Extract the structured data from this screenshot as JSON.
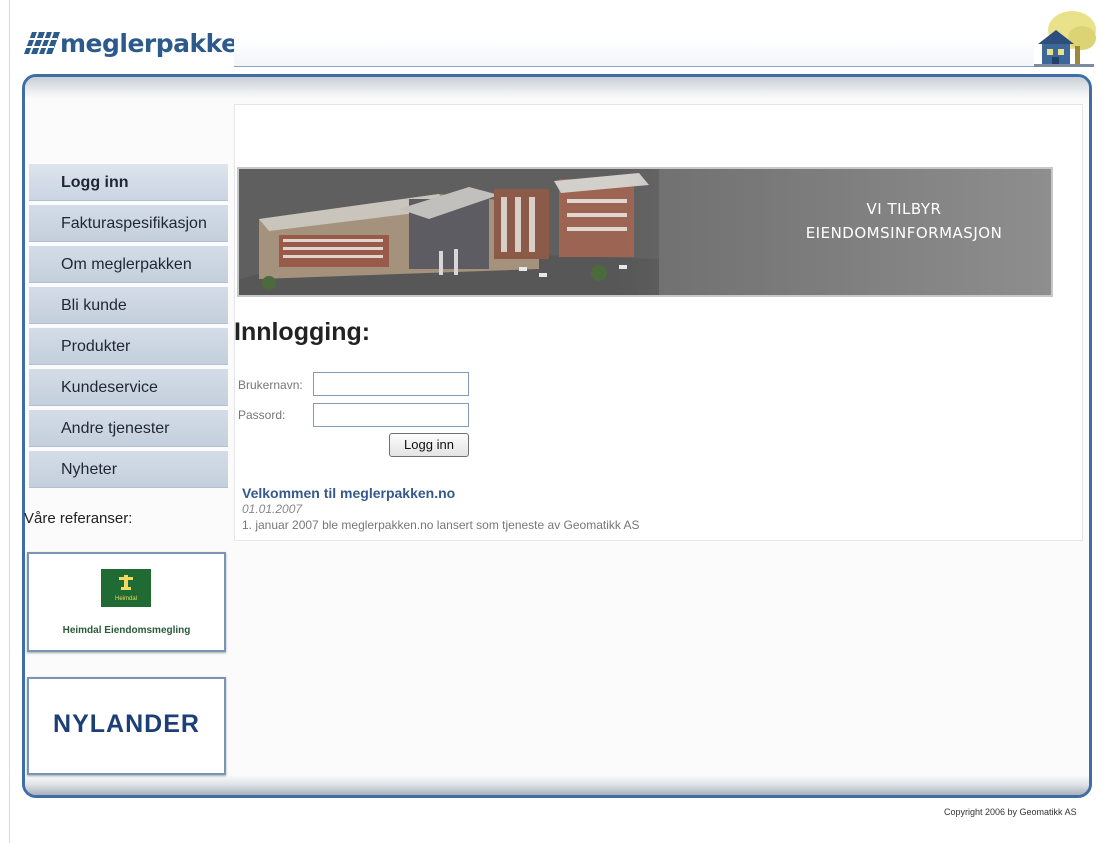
{
  "header": {
    "logo_text": "meglerpakken"
  },
  "sidebar": {
    "items": [
      {
        "label": "Logg inn"
      },
      {
        "label": "Fakturaspesifikasjon"
      },
      {
        "label": "Om meglerpakken"
      },
      {
        "label": "Bli kunde"
      },
      {
        "label": "Produkter"
      },
      {
        "label": "Kundeservice"
      },
      {
        "label": "Andre tjenester"
      },
      {
        "label": "Nyheter"
      }
    ],
    "active_index": 0,
    "references_label": "Våre referanser:",
    "references": [
      {
        "name": "Heimdal Eiendomsmegling",
        "emblem_text": "Heimdal"
      },
      {
        "name": "NYLANDER"
      }
    ]
  },
  "banner": {
    "line1": "VI TILBYR",
    "line2": "EIENDOMSINFORMASJON"
  },
  "login": {
    "title": "Innlogging:",
    "username_label": "Brukernavn:",
    "password_label": "Passord:",
    "username_value": "",
    "password_value": "",
    "submit_label": "Logg inn"
  },
  "news": {
    "title": "Velkommen til meglerpakken.no",
    "date": "01.01.2007",
    "text": "1. januar 2007 ble meglerpakken.no lansert som tjeneste av Geomatikk AS"
  },
  "footer": {
    "copyright": "Copyright 2006 by Geomatikk AS"
  },
  "colors": {
    "brand_blue": "#2d5a8c",
    "frame_border": "#3f6ea6",
    "nav_bg": "#c9d4e0",
    "link_blue": "#35598c"
  }
}
